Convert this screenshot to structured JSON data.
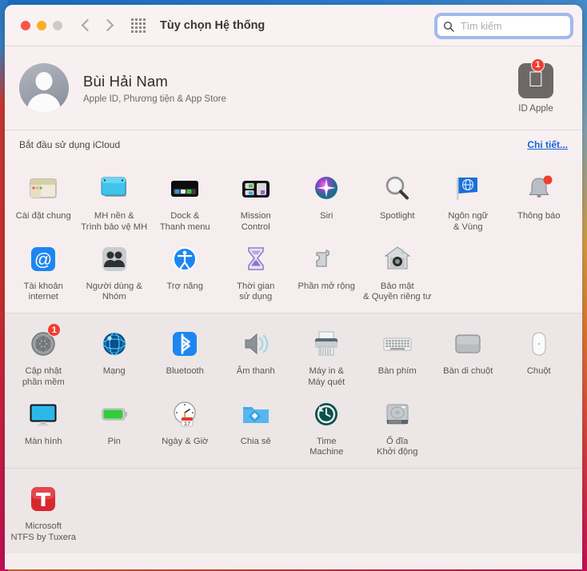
{
  "window": {
    "title": "Tùy chọn Hệ thống",
    "traffic_lights": [
      "close",
      "minimize",
      "zoom"
    ],
    "nav_back": "back-arrow",
    "nav_forward": "forward-arrow",
    "grid_button": "show-all-grid"
  },
  "search": {
    "placeholder": "Tìm kiếm",
    "value": "",
    "icon": "search-icon",
    "focused": true
  },
  "account": {
    "name": "Bùi  Hải Nam",
    "subtitle": "Apple ID, Phương tiện & App Store",
    "avatar": "user-avatar",
    "apple_id_label": "ID Apple",
    "apple_id_badge": "1",
    "apple_id_icon": "apple-logo-icon"
  },
  "icloud": {
    "text": "Bắt đầu sử dụng iCloud",
    "link": "Chi tiết..."
  },
  "colors": {
    "window_bg": "#f6eeee",
    "alt_row_bg": "#ece6e6",
    "titlebar_bg": "#faf2f2",
    "link": "#1a62d8",
    "badge_red": "#f03e2f",
    "focus_ring": "#5a8ce6"
  },
  "sections": [
    {
      "id": "section-general",
      "shade": "main",
      "rows": [
        [
          {
            "label": "Cài đặt chung",
            "icon": "general-settings-icon"
          },
          {
            "label": "MH nền &\nTrình bảo vệ MH",
            "icon": "desktop-screensaver-icon"
          },
          {
            "label": "Dock &\nThanh menu",
            "icon": "dock-menubar-icon"
          },
          {
            "label": "Mission\nControl",
            "icon": "mission-control-icon"
          },
          {
            "label": "Siri",
            "icon": "siri-icon"
          },
          {
            "label": "Spotlight",
            "icon": "spotlight-icon"
          },
          {
            "label": "Ngôn ngữ\n& Vùng",
            "icon": "language-region-icon"
          },
          {
            "label": "Thông báo",
            "icon": "notifications-icon",
            "badge": ""
          }
        ],
        [
          {
            "label": "Tài khoản\ninternet",
            "icon": "internet-accounts-icon"
          },
          {
            "label": "Người dùng &\nNhóm",
            "icon": "users-groups-icon"
          },
          {
            "label": "Trợ năng",
            "icon": "accessibility-icon"
          },
          {
            "label": "Thời gian\nsử dụng",
            "icon": "screen-time-icon"
          },
          {
            "label": "Phần mở rộng",
            "icon": "extensions-icon"
          },
          {
            "label": "Bảo mật\n& Quyền riêng tư",
            "icon": "security-privacy-icon"
          }
        ]
      ]
    },
    {
      "id": "section-hardware",
      "shade": "alt",
      "rows": [
        [
          {
            "label": "Cập nhật\nphần mềm",
            "icon": "software-update-icon",
            "badge": "1"
          },
          {
            "label": "Mạng",
            "icon": "network-icon"
          },
          {
            "label": "Bluetooth",
            "icon": "bluetooth-icon"
          },
          {
            "label": "Âm thanh",
            "icon": "sound-icon"
          },
          {
            "label": "Máy in &\nMáy quét",
            "icon": "printers-scanners-icon"
          },
          {
            "label": "Bàn phím",
            "icon": "keyboard-icon"
          },
          {
            "label": "Bàn di chuột",
            "icon": "trackpad-icon"
          },
          {
            "label": "Chuột",
            "icon": "mouse-icon"
          }
        ],
        [
          {
            "label": "Màn hình",
            "icon": "displays-icon"
          },
          {
            "label": "Pin",
            "icon": "battery-icon"
          },
          {
            "label": "Ngày & Giờ",
            "icon": "date-time-icon"
          },
          {
            "label": "Chia sẻ",
            "icon": "sharing-icon"
          },
          {
            "label": "Time\nMachine",
            "icon": "time-machine-icon"
          },
          {
            "label": "Ổ đĩa\nKhởi động",
            "icon": "startup-disk-icon"
          }
        ]
      ]
    },
    {
      "id": "section-third-party",
      "shade": "alt",
      "rows": [
        [
          {
            "label": "Microsoft\nNTFS by Tuxera",
            "icon": "tuxera-ntfs-icon"
          }
        ]
      ]
    }
  ]
}
